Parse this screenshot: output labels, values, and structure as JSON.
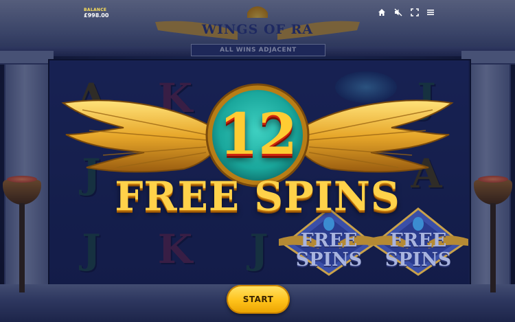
{
  "header": {
    "balance_label": "BALANCE",
    "balance_value": "£998.00",
    "icons": [
      "home-icon",
      "sound-off-icon",
      "fullscreen-icon",
      "menu-icon"
    ]
  },
  "logo": {
    "title": "WINGS OF RA",
    "subtitle": "ALL WINS ADJACENT"
  },
  "reels": {
    "symbols": [
      [
        "A",
        "J",
        "J"
      ],
      [
        "K",
        "",
        "K"
      ],
      [
        "",
        "",
        "J"
      ],
      [
        "",
        "",
        ""
      ],
      [
        "J",
        "A",
        ""
      ]
    ]
  },
  "free_spins_popup": {
    "count": "12",
    "label": "FREE SPINS"
  },
  "scatter_symbols": [
    {
      "line1": "FREE",
      "line2": "SPINS"
    },
    {
      "line1": "FREE",
      "line2": "SPINS"
    }
  ],
  "start_button": {
    "label": "START"
  },
  "colors": {
    "gold": "#ffd24a",
    "accent_yellow": "#ffe259",
    "teal_medallion": "#1aa79c",
    "reel_blue": "#1e2a62"
  }
}
